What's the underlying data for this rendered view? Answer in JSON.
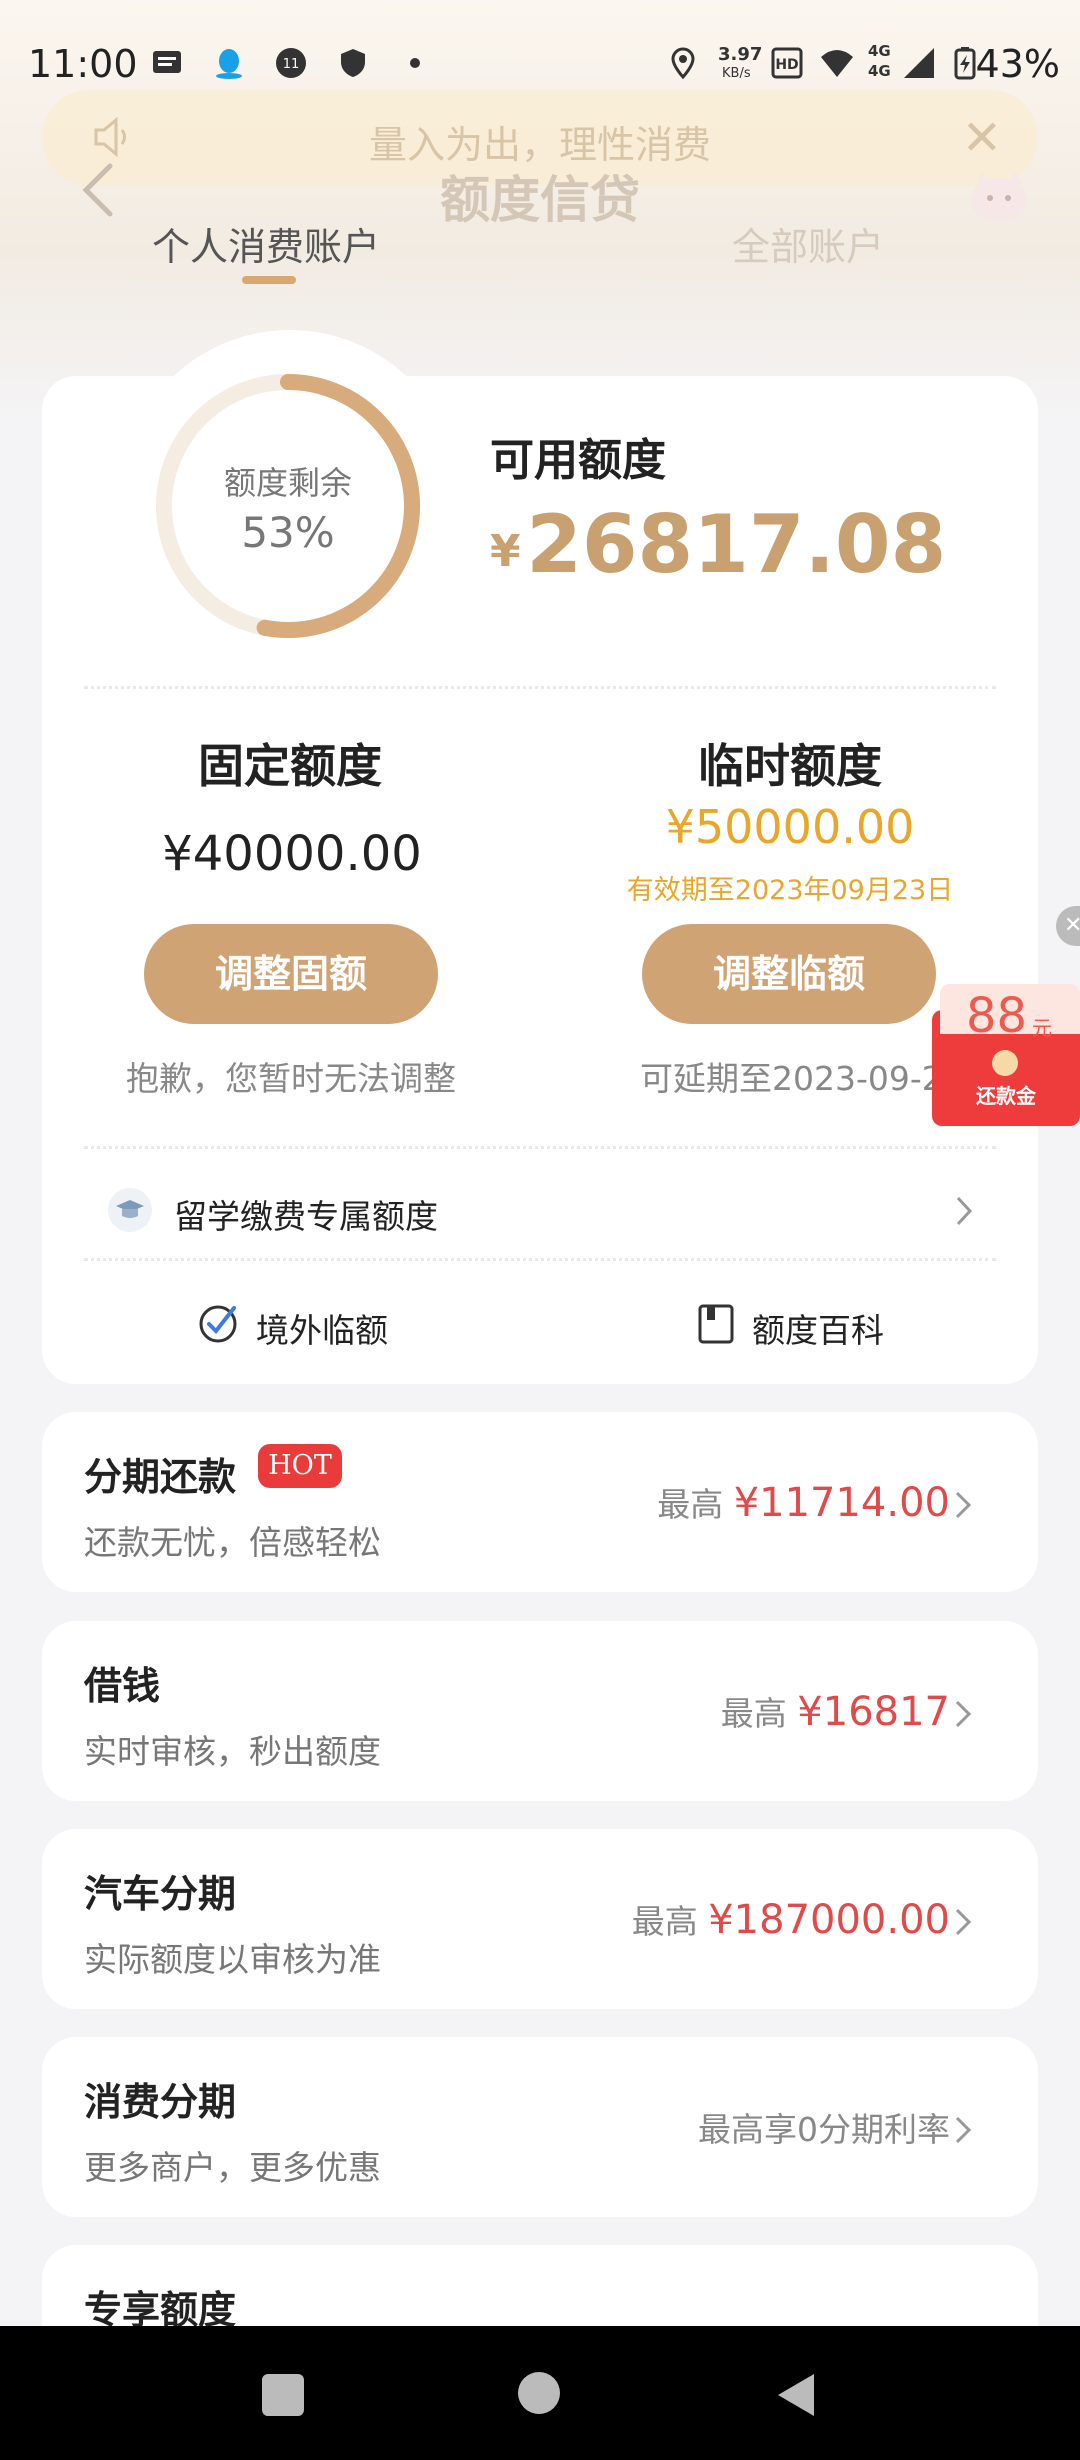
{
  "status_bar": {
    "time": "11:00",
    "net_speed_value": "3.97",
    "net_speed_unit": "KB/s",
    "network": "4G",
    "battery": "43%"
  },
  "notice": {
    "text": "量入为出，理性消费"
  },
  "header": {
    "title": "额度信贷"
  },
  "tabs": [
    {
      "label": "个人消费账户",
      "active": true
    },
    {
      "label": "全部账户",
      "active": false
    }
  ],
  "credit": {
    "ring_label": "额度剩余",
    "ring_value": "53%",
    "ring_fraction": 0.53,
    "available_label": "可用额度",
    "available_currency": "¥",
    "available_amount": "26817.08",
    "fixed": {
      "title": "固定额度",
      "amount": "¥40000.00",
      "button": "调整固额",
      "note": "抱歉，您暂时无法调整"
    },
    "temp": {
      "title": "临时额度",
      "amount": "¥50000.00",
      "valid": "有效期至2023年09月23日",
      "button": "调整临额",
      "note": "可延期至2023-09-26"
    },
    "study_abroad": "留学缴费专属额度",
    "links": {
      "overseas": "境外临额",
      "wiki": "额度百科"
    }
  },
  "float_promo": {
    "amount": "88",
    "unit": "元",
    "label": "还款金"
  },
  "services": [
    {
      "title": "分期还款",
      "badge": "HOT",
      "subtitle": "还款无忧，倍感轻松",
      "prefix": "最高",
      "amount": "¥11714.00"
    },
    {
      "title": "借钱",
      "subtitle": "实时审核，秒出额度",
      "prefix": "最高",
      "amount": "¥16817"
    },
    {
      "title": "汽车分期",
      "subtitle": "实际额度以审核为准",
      "prefix": "最高",
      "amount": "¥187000.00"
    },
    {
      "title": "消费分期",
      "subtitle": "更多商户，更多优惠",
      "prefix": "最高享0分期利率",
      "amount": ""
    },
    {
      "title": "专享额度",
      "subtitle": "",
      "prefix": "",
      "amount": ""
    }
  ],
  "colors": {
    "accent_gold": "#cfa374",
    "amount_red": "#e04a4a",
    "temp_orange": "#e8a72a"
  }
}
